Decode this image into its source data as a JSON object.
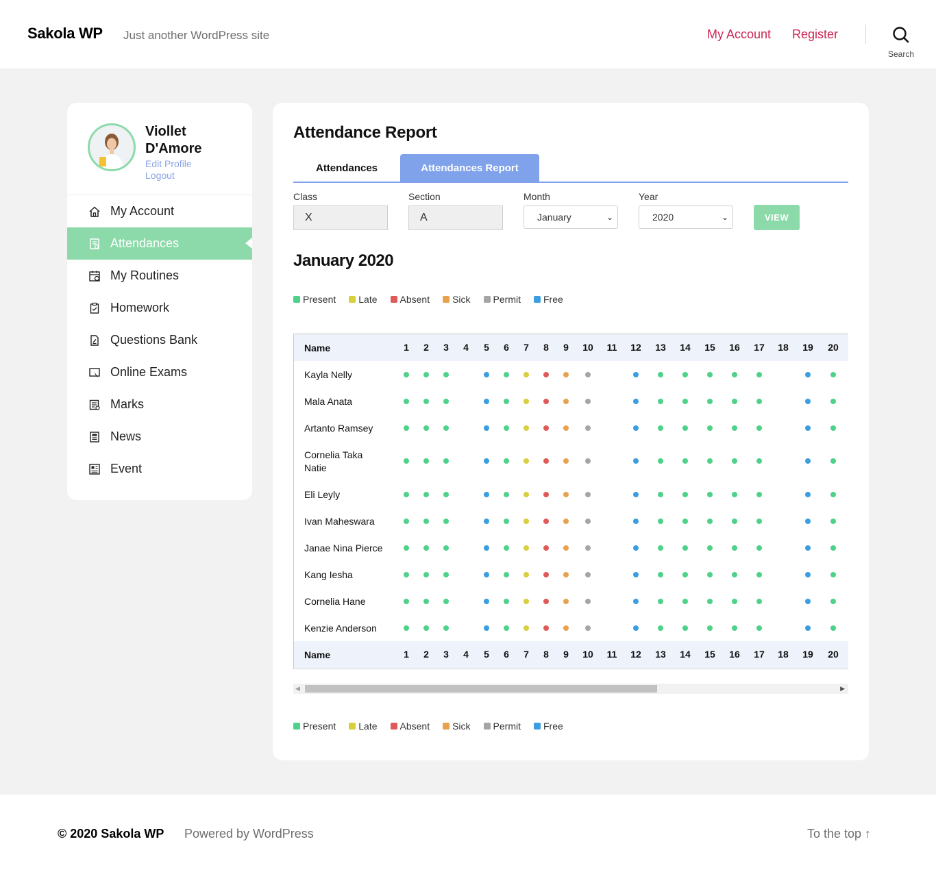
{
  "site": {
    "title": "Sakola WP",
    "tagline": "Just another WordPress site"
  },
  "nav": {
    "my_account": "My Account",
    "register": "Register",
    "search": "Search"
  },
  "profile": {
    "name_line1": "Viollet",
    "name_line2": "D'Amore",
    "edit_profile": "Edit Profile",
    "logout": "Logout"
  },
  "menu": [
    {
      "label": "My Account",
      "icon": "home-icon",
      "active": false
    },
    {
      "label": "Attendances",
      "icon": "attendance-report-icon",
      "active": true
    },
    {
      "label": "My Routines",
      "icon": "calendar-clock-icon",
      "active": false
    },
    {
      "label": "Homework",
      "icon": "clipboard-check-icon",
      "active": false
    },
    {
      "label": "Questions Bank",
      "icon": "document-edit-icon",
      "active": false
    },
    {
      "label": "Online Exams",
      "icon": "online-exam-icon",
      "active": false
    },
    {
      "label": "Marks",
      "icon": "marks-list-icon",
      "active": false
    },
    {
      "label": "News",
      "icon": "newspaper-icon",
      "active": false
    },
    {
      "label": "Event",
      "icon": "event-board-icon",
      "active": false
    }
  ],
  "main": {
    "title": "Attendance Report",
    "tabs": [
      "Attendances",
      "Attendances Report"
    ],
    "filters": {
      "class_label": "Class",
      "class_value": "X",
      "section_label": "Section",
      "section_value": "A",
      "month_label": "Month",
      "month_value": "January",
      "year_label": "Year",
      "year_value": "2020",
      "view_button": "VIEW"
    },
    "month_title": "January 2020",
    "legend": [
      {
        "label": "Present",
        "color": "#4ed28a"
      },
      {
        "label": "Late",
        "color": "#d7cf3e"
      },
      {
        "label": "Absent",
        "color": "#e05a5a"
      },
      {
        "label": "Sick",
        "color": "#e7a24e"
      },
      {
        "label": "Permit",
        "color": "#a5a5a5"
      },
      {
        "label": "Free",
        "color": "#3a9ee0"
      }
    ],
    "table": {
      "name_header": "Name",
      "days": [
        "1",
        "2",
        "3",
        "4",
        "5",
        "6",
        "7",
        "8",
        "9",
        "10",
        "11",
        "12",
        "13",
        "14",
        "15",
        "16",
        "17",
        "18",
        "19",
        "20"
      ],
      "pattern": [
        "Present",
        "Present",
        "Present",
        "",
        "Free",
        "Present",
        "Late",
        "Absent",
        "Sick",
        "Permit",
        "",
        "Free",
        "Present",
        "Present",
        "Present",
        "Present",
        "Present",
        "",
        "Free",
        "Present"
      ],
      "students": [
        "Kayla Nelly",
        "Mala Anata",
        "Artanto Ramsey",
        "Cornelia Taka Natie",
        "Eli Leyly",
        "Ivan Maheswara",
        "Janae Nina Pierce",
        "Kang Iesha",
        "Cornelia Hane",
        "Kenzie Anderson"
      ]
    }
  },
  "footer": {
    "copyright": "© 2020 Sakola WP",
    "powered": "Powered by WordPress",
    "to_top": "To the top ↑"
  }
}
